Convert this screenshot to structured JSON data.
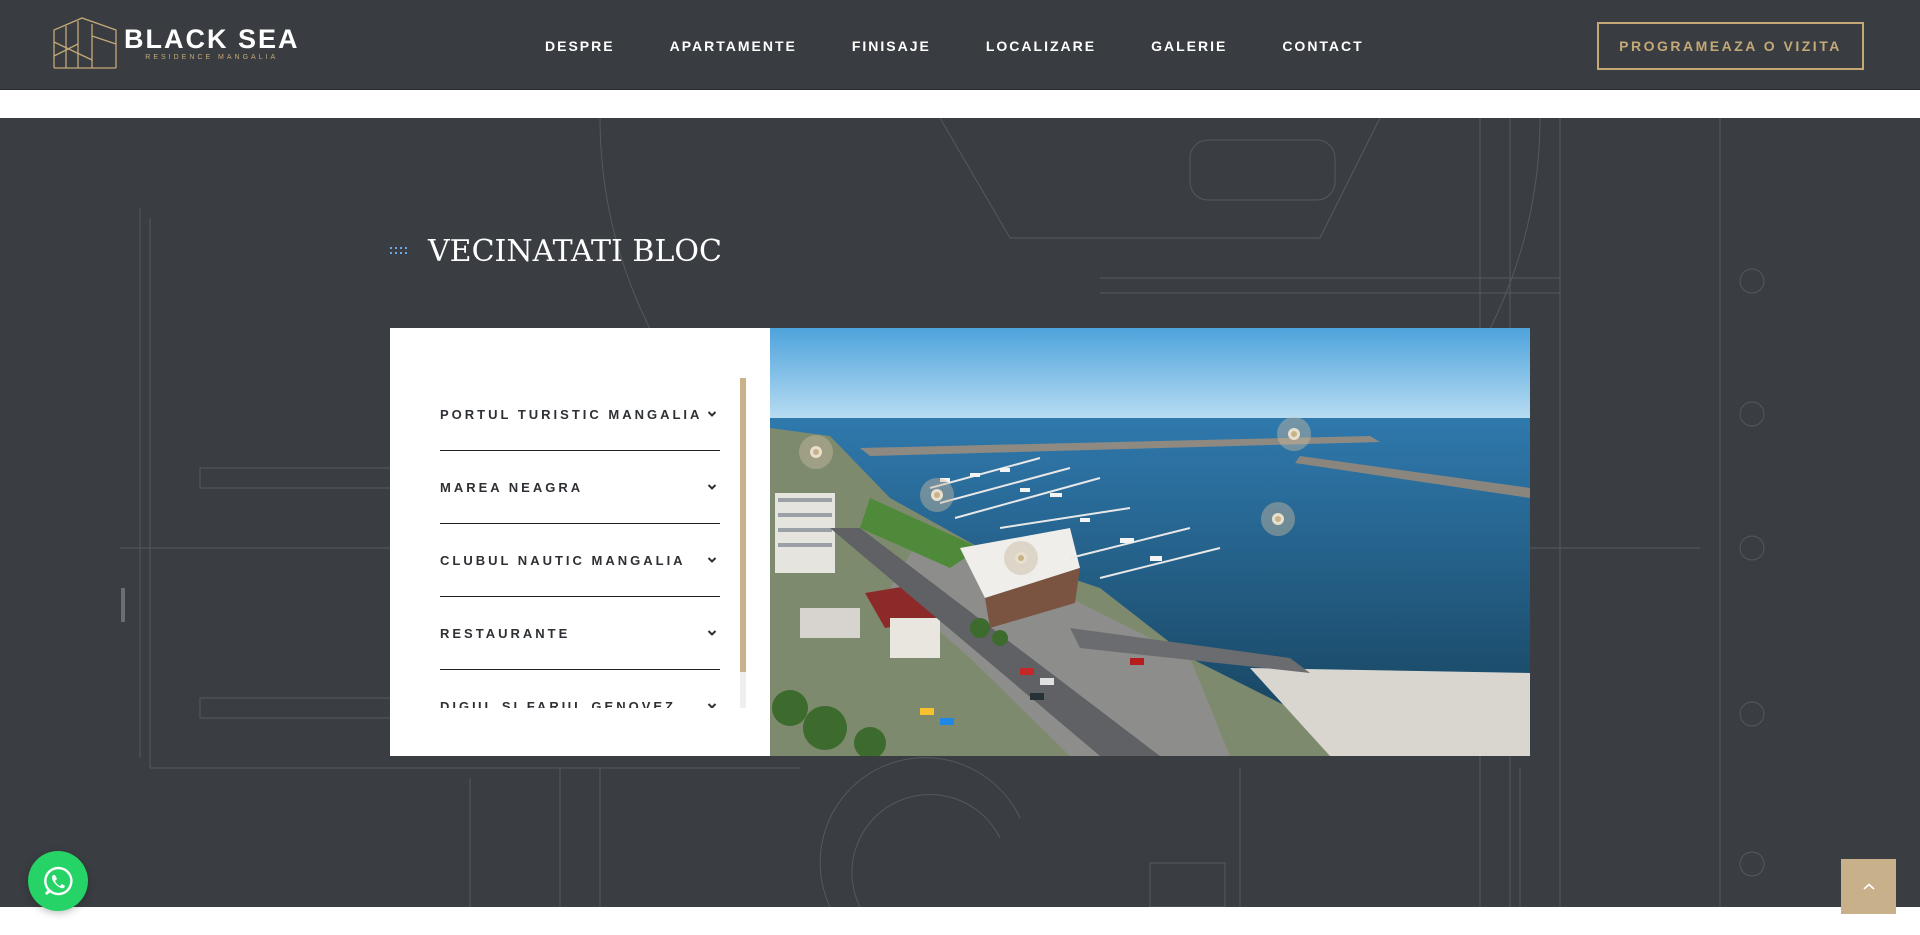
{
  "brand": {
    "name": "BLACK SEA",
    "tagline": "RESIDENCE MANGALIA"
  },
  "nav": {
    "items": [
      "DESPRE",
      "APARTAMENTE",
      "FINISAJE",
      "LOCALIZARE",
      "GALERIE",
      "CONTACT"
    ]
  },
  "cta": {
    "label": "PROGRAMEAZA O VIZITA"
  },
  "section": {
    "title": "VECINATATI BLOC",
    "items": [
      "PORTUL TURISTIC MANGALIA",
      "MAREA NEAGRA",
      "CLUBUL NAUTIC MANGALIA",
      "RESTAURANTE",
      "DIGUL SI FARUL GENOVEZ"
    ]
  },
  "icons": {
    "title": "dots-icon",
    "chevron": "chevron-down-icon",
    "whatsapp": "whatsapp-icon",
    "top": "chevron-up-icon",
    "pin": "map-pin-icon"
  },
  "colors": {
    "header": "#393d41",
    "section": "#3a3e42",
    "gold": "#c4a977",
    "accent": "#6aa8e8",
    "whatsapp": "#25d366"
  },
  "map_pins": 5
}
